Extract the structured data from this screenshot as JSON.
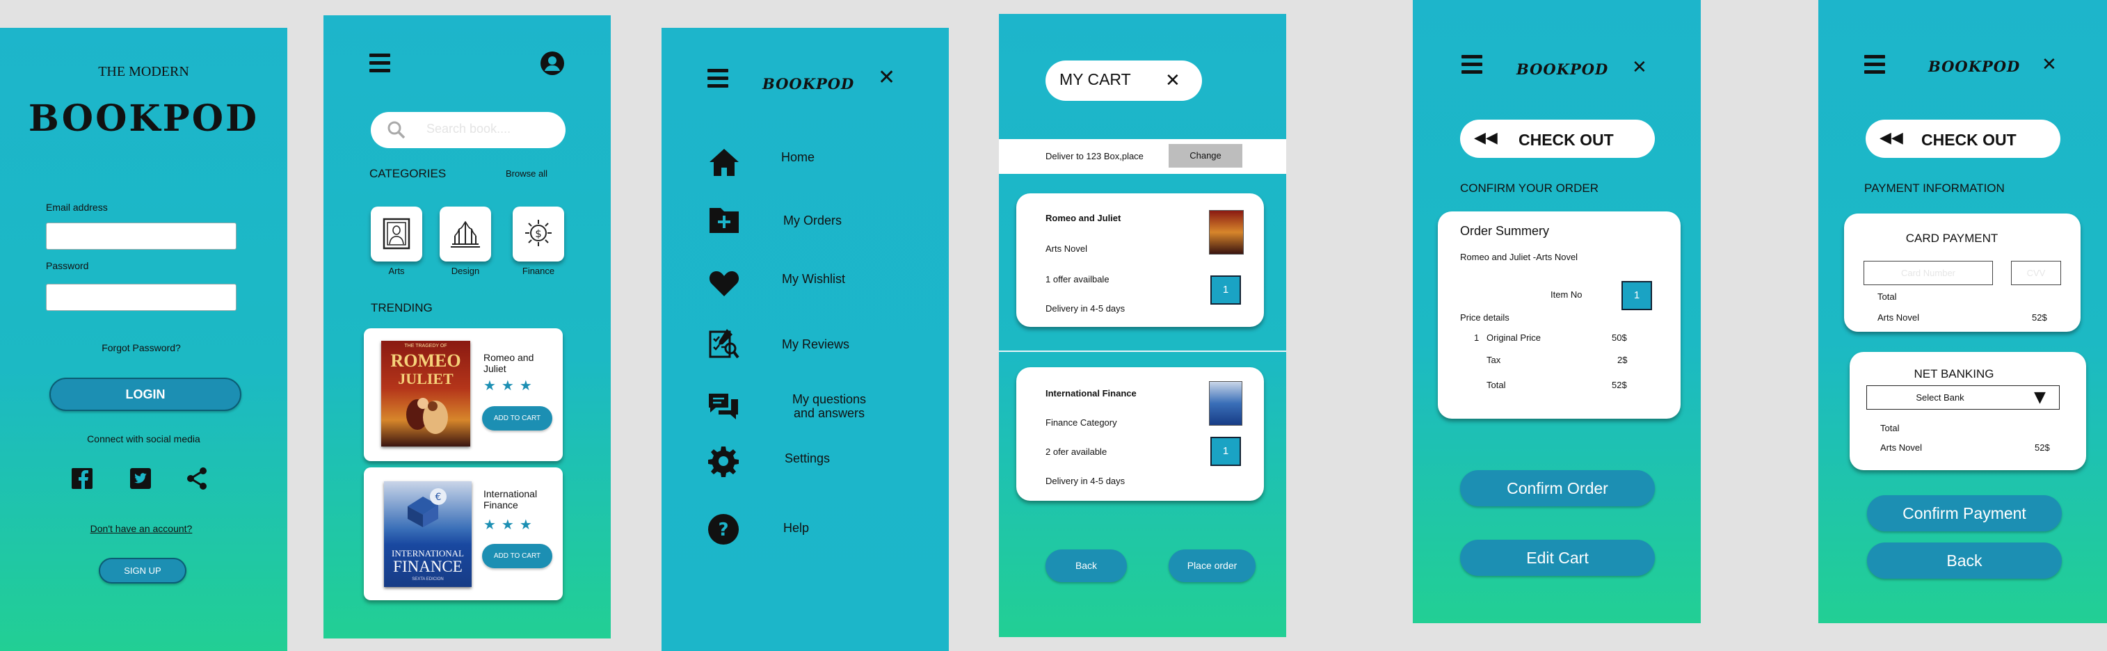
{
  "login": {
    "subtitle": "THE MODERN",
    "brand": "BOOKPOD",
    "email_label": "Email address",
    "password_label": "Password",
    "forgot": "Forgot Password?",
    "login_button": "LOGIN",
    "social_text": "Connect with social media",
    "no_account": "Don't have an account?",
    "signup_button": "SIGN UP"
  },
  "home": {
    "search_placeholder": "Search book....",
    "categories_title": "CATEGORIES",
    "browse_all": "Browse all",
    "categories": [
      {
        "label": "Arts"
      },
      {
        "label": "Design"
      },
      {
        "label": "Finance"
      }
    ],
    "trending_title": "TRENDING",
    "books": [
      {
        "title": "Romeo and Juliet",
        "cover_top": "ROMEO",
        "cover_mid": "JULIET",
        "cover_small": "THE TRAGEDY OF",
        "add_label": "ADD TO CART",
        "rating": 3
      },
      {
        "title": "International Finance",
        "cover_top": "INTERNATIONAL",
        "cover_mid": "FINANCE",
        "cover_small": "SEXTA EDICION",
        "add_label": "ADD TO CART",
        "rating": 3
      }
    ]
  },
  "menu": {
    "brand": "BOOKPOD",
    "items": [
      {
        "label": "Home",
        "icon": "home-icon"
      },
      {
        "label": "My Orders",
        "icon": "folder-plus-icon"
      },
      {
        "label": "My Wishlist",
        "icon": "heart-icon"
      },
      {
        "label": "My Reviews",
        "icon": "review-icon"
      },
      {
        "label": "My questions and answers",
        "icon": "chat-icon"
      },
      {
        "label": "Settings",
        "icon": "gear-icon"
      },
      {
        "label": "Help",
        "icon": "help-icon"
      }
    ]
  },
  "cart": {
    "title": "MY CART",
    "deliver_text": "Deliver to 123 Box,place",
    "change_button": "Change",
    "items": [
      {
        "title": "Romeo and Juliet",
        "category": "Arts Novel",
        "offer": "1 offer availbale",
        "delivery": "Delivery in 4-5 days",
        "qty": "1"
      },
      {
        "title": "International Finance",
        "category": "Finance Category",
        "offer": "2 ofer available",
        "delivery": "Delivery in 4-5 days",
        "qty": "1"
      }
    ],
    "back_button": "Back",
    "place_order_button": "Place order"
  },
  "checkout": {
    "brand": "BOOKPOD",
    "header_button": "CHECK OUT",
    "confirm_title": "CONFIRM YOUR ORDER",
    "summary_title": "Order Summery",
    "summary_item": "Romeo and Juliet -Arts Novel",
    "item_no_label": "Item No",
    "item_no_value": "1",
    "price_details": "Price details",
    "rows": [
      {
        "num": "1",
        "label": "Original Price",
        "value": "50$"
      },
      {
        "num": "",
        "label": "Tax",
        "value": "2$"
      },
      {
        "num": "",
        "label": "Total",
        "value": "52$"
      }
    ],
    "confirm_button": "Confirm Order",
    "edit_button": "Edit Cart"
  },
  "payment": {
    "brand": "BOOKPOD",
    "header_button": "CHECK OUT",
    "title": "PAYMENT INFORMATION",
    "card_title": "CARD PAYMENT",
    "card_number_placeholder": "Card Number",
    "cvv_placeholder": "CVV",
    "total_label": "Total",
    "item_label": "Arts Novel",
    "item_value": "52$",
    "net_title": "NET BANKING",
    "select_bank": "Select Bank",
    "net_total_label": "Total",
    "net_item_label": "Arts Novel",
    "net_item_value": "52$",
    "confirm_button": "Confirm Payment",
    "back_button": "Back"
  },
  "colors": {
    "accent": "#1c8fb3",
    "screen_top": "#1db5cb",
    "screen_bottom": "#22cf94",
    "qty": "#1aa3c4"
  }
}
